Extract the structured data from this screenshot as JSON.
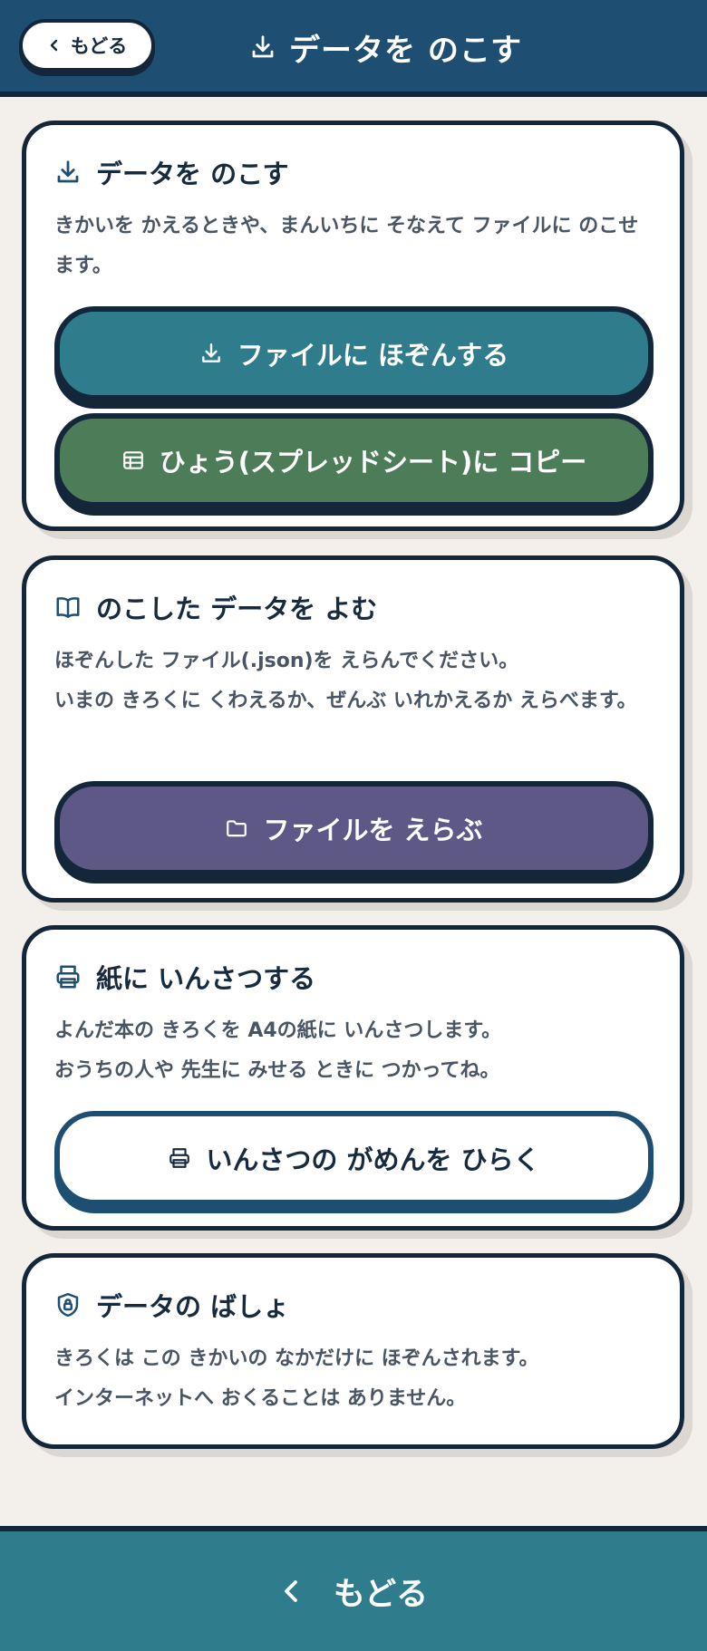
{
  "header": {
    "back_label": "もどる",
    "title": "データを のこす",
    "back_icon": "chevron-left-icon",
    "title_icon": "download-icon"
  },
  "cards": {
    "save": {
      "title": "データを のこす",
      "icon": "download-icon",
      "text": "きかいを かえるときや、まんいちに そなえて ファイルに のこせます。",
      "save_file_label": "ファイルに ほぞんする",
      "copy_sheet_label": "ひょう(スプレッドシート)に コピー"
    },
    "load": {
      "title": "のこした データを よむ",
      "icon": "book-open-icon",
      "text_line1": "ほぞんした ファイル(.json)を えらんでください。",
      "text_line2": "いまの きろくに くわえるか、ぜんぶ いれかえるか えらべます。",
      "choose_file_label": "ファイルを えらぶ"
    },
    "print": {
      "title": "紙に いんさつする",
      "icon": "printer-icon",
      "text_line1": "よんだ本の きろくを A4の紙に いんさつします。",
      "text_line2": "おうちの人や 先生に みせる ときに つかってね。",
      "open_print_label": "いんさつの がめんを ひらく"
    },
    "storage": {
      "title": "データの ばしょ",
      "icon": "shield-lock-icon",
      "text_line1": "きろくは この きかいの なかだけに ほぞんされます。",
      "text_line2": "インターネットへ おくることは ありません。"
    }
  },
  "footer": {
    "back_label": "もどる"
  },
  "colors": {
    "header": "#1f4e73",
    "ink": "#13263a",
    "background": "#f3f0eb",
    "teal": "#2e7c8c",
    "green": "#4d7d58",
    "purple": "#5e5886"
  }
}
